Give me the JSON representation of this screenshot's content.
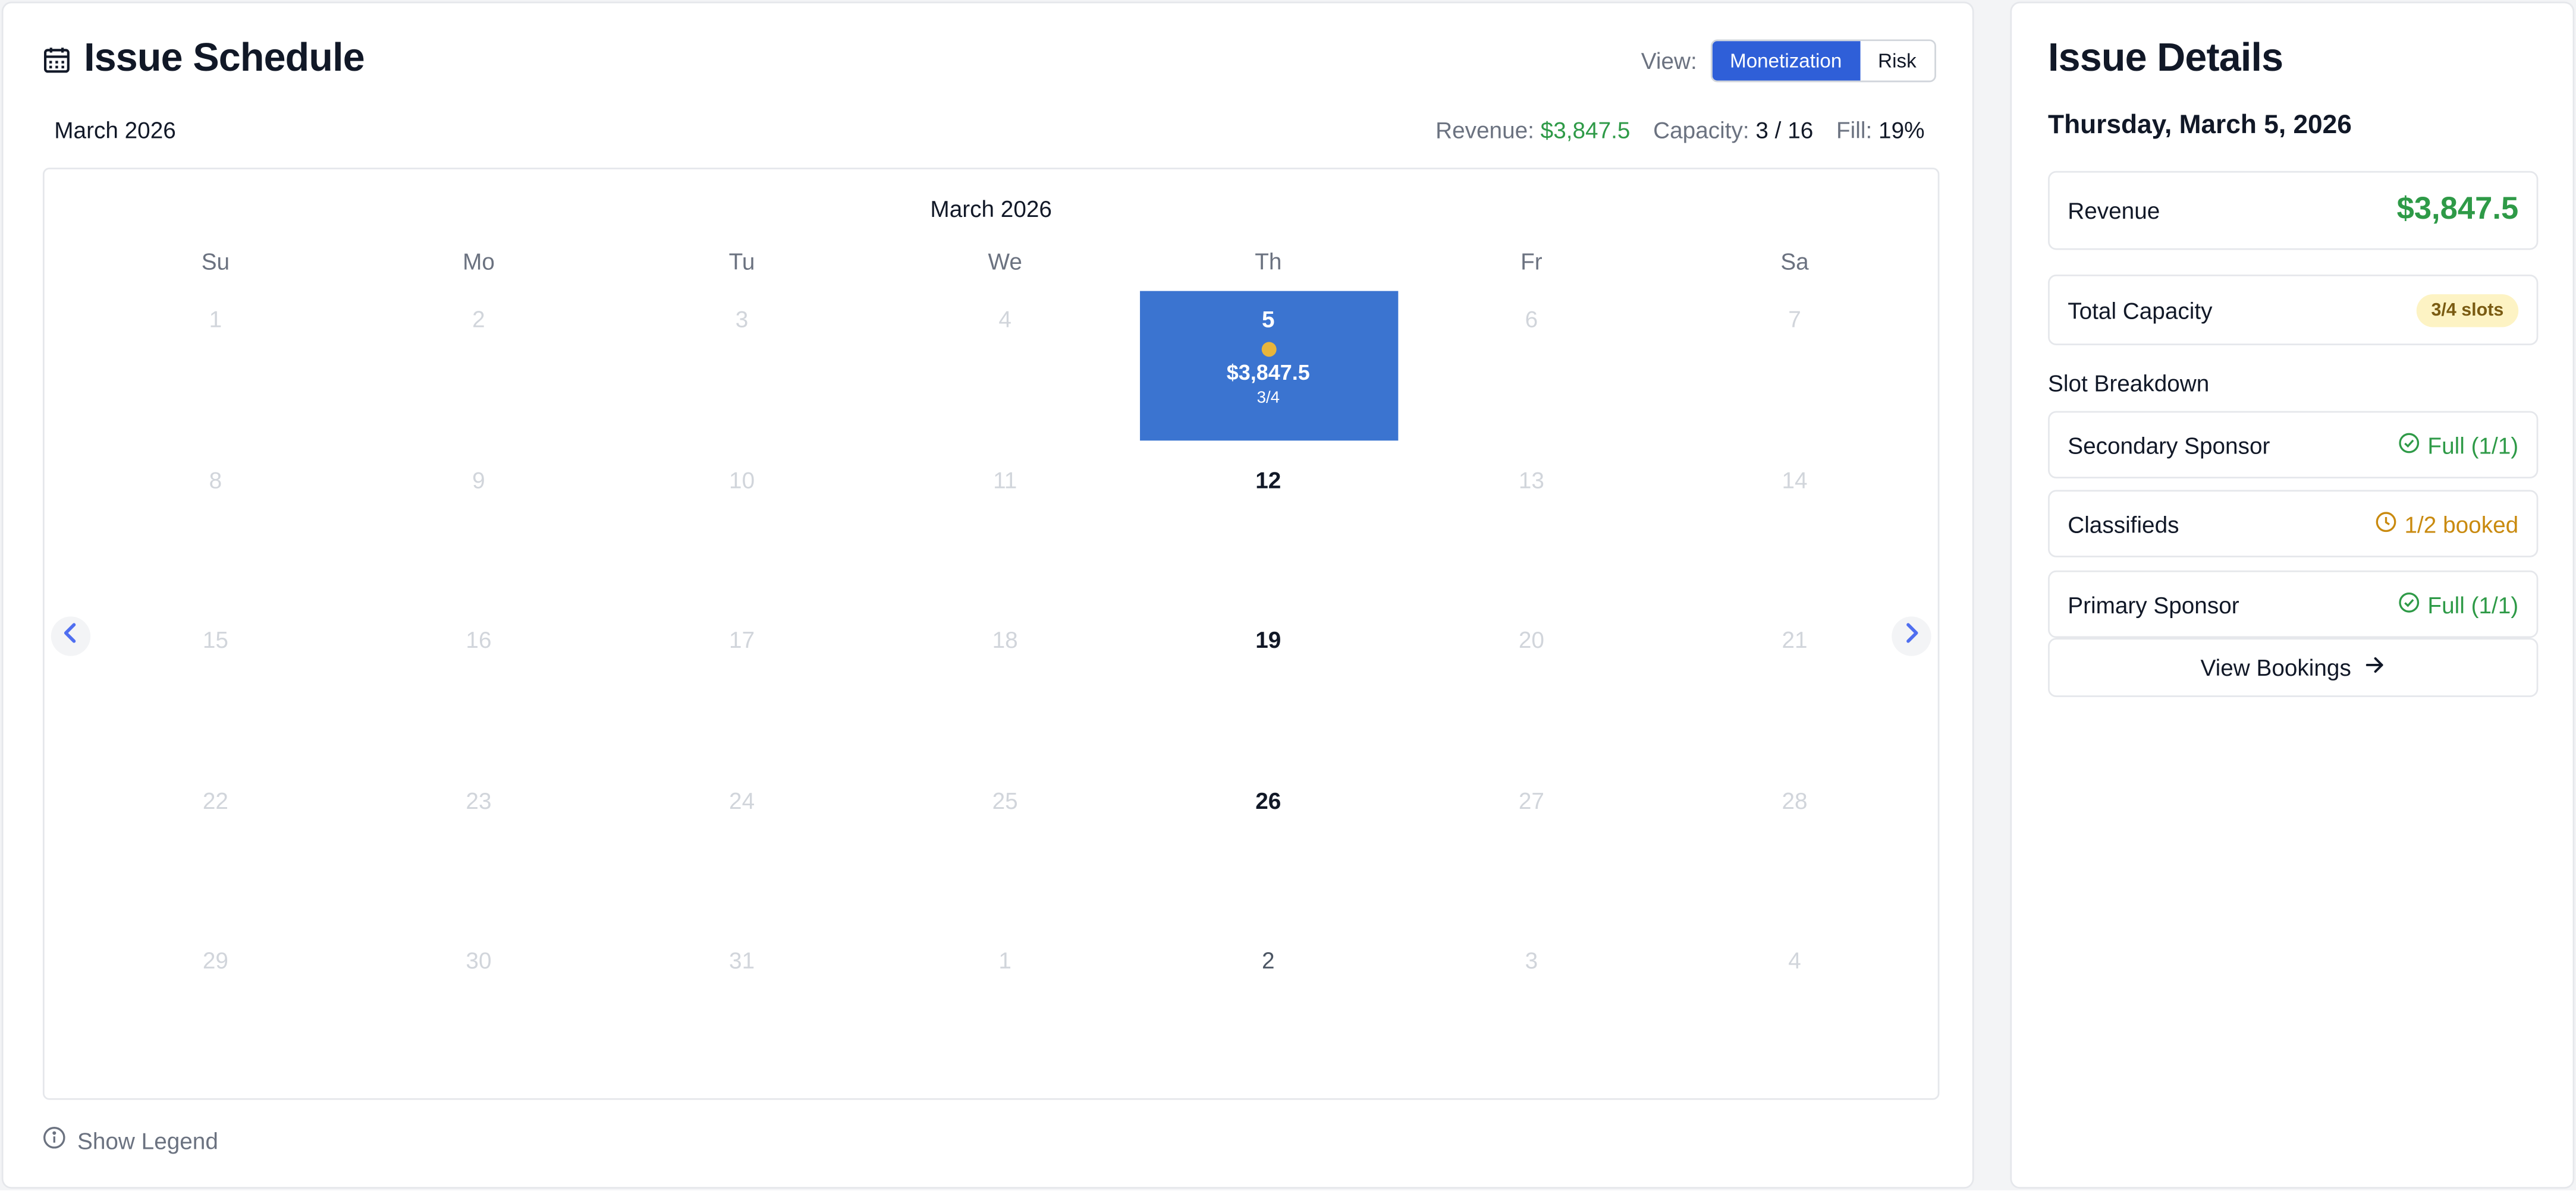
{
  "schedule": {
    "title": "Issue Schedule",
    "view_label": "View:",
    "view_options": [
      "Monetization",
      "Risk"
    ],
    "active_view": "Monetization",
    "month": "March 2026",
    "calendar_caption": "March 2026",
    "stats": {
      "revenue_label": "Revenue:",
      "revenue_value": "$3,847.5",
      "capacity_label": "Capacity:",
      "capacity_value": "3 / 16",
      "fill_label": "Fill:",
      "fill_value": "19%"
    },
    "weekdays": [
      "Su",
      "Mo",
      "Tu",
      "We",
      "Th",
      "Fr",
      "Sa"
    ],
    "weeks": [
      [
        "1",
        "2",
        "3",
        "4",
        "5",
        "6",
        "7"
      ],
      [
        "8",
        "9",
        "10",
        "11",
        "12",
        "13",
        "14"
      ],
      [
        "15",
        "16",
        "17",
        "18",
        "19",
        "20",
        "21"
      ],
      [
        "22",
        "23",
        "24",
        "25",
        "26",
        "27",
        "28"
      ],
      [
        "29",
        "30",
        "31",
        "1",
        "2",
        "3",
        "4"
      ]
    ],
    "selected_day": {
      "revenue": "$3,847.5",
      "capacity": "3/4"
    },
    "legend_toggle": "Show Legend"
  },
  "details": {
    "title": "Issue Details",
    "date": "Thursday, March 5, 2026",
    "revenue_label": "Revenue",
    "revenue_value": "$3,847.5",
    "capacity_label": "Total Capacity",
    "capacity_badge": "3/4 slots",
    "breakdown_label": "Slot Breakdown",
    "slots": [
      {
        "name": "Secondary Sponsor",
        "status": "Full (1/1)",
        "state": "full"
      },
      {
        "name": "Classifieds",
        "status": "1/2 booked",
        "state": "partial"
      },
      {
        "name": "Primary Sponsor",
        "status": "Full (1/1)",
        "state": "full"
      }
    ],
    "view_bookings": "View Bookings"
  },
  "colors": {
    "accent": "#2f5fd8",
    "selected_day": "#3b74d0",
    "revenue_green": "#2e9a47",
    "warning_amber": "#c98a0f",
    "dot_yellow": "#e8b53b"
  },
  "icons": [
    "calendar-icon",
    "chevron-left-icon",
    "chevron-right-icon",
    "info-icon",
    "check-circle-icon",
    "clock-icon",
    "arrow-right-icon"
  ]
}
